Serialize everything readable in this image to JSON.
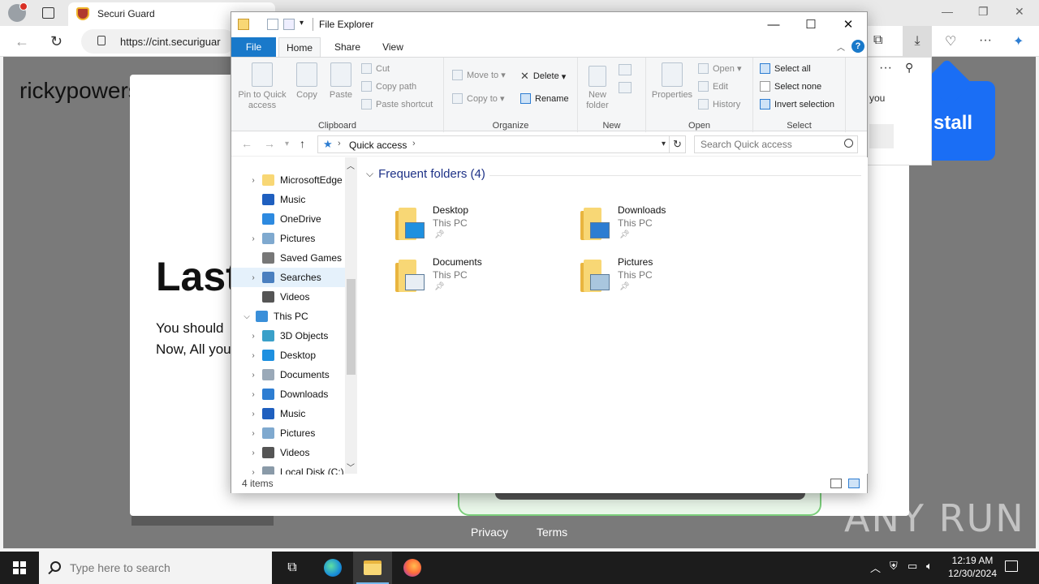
{
  "browser": {
    "tab_title": "Securi Guard",
    "url": "https://cint.securiguar",
    "site_name": "rickypowersports",
    "heading": "Last",
    "body_line1": "You should",
    "body_line2": "Now, All you",
    "footer_privacy": "Privacy",
    "footer_terms": "Terms",
    "install_badge": "stall",
    "popup_text": "you",
    "watermark": "ANY RUN"
  },
  "explorer": {
    "title": "File Explorer",
    "tabs": {
      "file": "File",
      "home": "Home",
      "share": "Share",
      "view": "View"
    },
    "help": "?",
    "ribbon": {
      "clipboard": {
        "label": "Clipboard",
        "pin": "Pin to Quick access",
        "copy": "Copy",
        "paste": "Paste",
        "cut": "Cut",
        "copy_path": "Copy path",
        "paste_shortcut": "Paste shortcut"
      },
      "organize": {
        "label": "Organize",
        "move_to": "Move to",
        "copy_to": "Copy to",
        "delete": "Delete",
        "rename": "Rename"
      },
      "new": {
        "label": "New",
        "new_folder": "New folder"
      },
      "open": {
        "label": "Open",
        "properties": "Properties",
        "open": "Open",
        "edit": "Edit",
        "history": "History"
      },
      "select": {
        "label": "Select",
        "select_all": "Select all",
        "select_none": "Select none",
        "invert": "Invert selection"
      }
    },
    "address": {
      "crumb": "Quick access",
      "search_placeholder": "Search Quick access"
    },
    "nav": [
      {
        "label": "MicrosoftEdge",
        "expander": ">",
        "color": "#f8d775"
      },
      {
        "label": "Music",
        "expander": "",
        "color": "#1f5fbf"
      },
      {
        "label": "OneDrive",
        "expander": "",
        "color": "#2d8ae0"
      },
      {
        "label": "Pictures",
        "expander": ">",
        "color": "#7fa9cf"
      },
      {
        "label": "Saved Games",
        "expander": "",
        "color": "#777777"
      },
      {
        "label": "Searches",
        "expander": ">",
        "color": "#4a7fbf"
      },
      {
        "label": "Videos",
        "expander": "",
        "color": "#555555"
      },
      {
        "label": "This PC",
        "expander": "v",
        "color": "#3a8fd9"
      },
      {
        "label": "3D Objects",
        "expander": ">",
        "color": "#3aa0c9"
      },
      {
        "label": "Desktop",
        "expander": ">",
        "color": "#1e90e0"
      },
      {
        "label": "Documents",
        "expander": ">",
        "color": "#9aa9b8"
      },
      {
        "label": "Downloads",
        "expander": ">",
        "color": "#2d7dd2"
      },
      {
        "label": "Music",
        "expander": ">",
        "color": "#1f5fbf"
      },
      {
        "label": "Pictures",
        "expander": ">",
        "color": "#7fa9cf"
      },
      {
        "label": "Videos",
        "expander": ">",
        "color": "#555555"
      },
      {
        "label": "Local Disk (C:)",
        "expander": ">",
        "color": "#8a9aa8"
      }
    ],
    "group_header": "Frequent folders (4)",
    "folders": [
      {
        "name": "Desktop",
        "location": "This PC",
        "overlay": "#1e90e0"
      },
      {
        "name": "Downloads",
        "location": "This PC",
        "overlay": "#2d7dd2"
      },
      {
        "name": "Documents",
        "location": "This PC",
        "overlay": "#e8eef4"
      },
      {
        "name": "Pictures",
        "location": "This PC",
        "overlay": "#a9c6de"
      }
    ],
    "status": "4 items"
  },
  "taskbar": {
    "search_placeholder": "Type here to search",
    "time": "12:19 AM",
    "date": "12/30/2024"
  }
}
